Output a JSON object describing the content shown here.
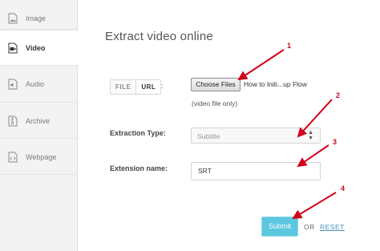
{
  "sidebar": {
    "items": [
      {
        "label": "Image",
        "icon": "image-file-icon"
      },
      {
        "label": "Video",
        "icon": "video-file-icon"
      },
      {
        "label": "Audio",
        "icon": "audio-file-icon"
      },
      {
        "label": "Archive",
        "icon": "archive-file-icon"
      },
      {
        "label": "Webpage",
        "icon": "code-file-icon"
      }
    ],
    "active": "Video"
  },
  "main": {
    "title": "Extract video online",
    "source_tabs": [
      {
        "label": "FILE"
      },
      {
        "label": "URL"
      }
    ],
    "active_source_tab": "URL",
    "colon": ":",
    "choose_button": "Choose Files",
    "file_name": "How to Initi...up Flow",
    "hint": "(video file only)",
    "extraction_type": {
      "label": "Extraction Type:",
      "value": "Subtitle"
    },
    "extension_name": {
      "label": "Extension name:",
      "value": "SRT"
    },
    "submit": "Submit",
    "or": "OR",
    "reset": "RESET"
  },
  "annotations": {
    "color": "#d0021b",
    "steps": [
      "1",
      "2",
      "3",
      "4"
    ]
  },
  "colors": {
    "sidebar_bg": "#f3f3f3",
    "submit_bg": "#5cc7e0",
    "link": "#4a90b8"
  }
}
